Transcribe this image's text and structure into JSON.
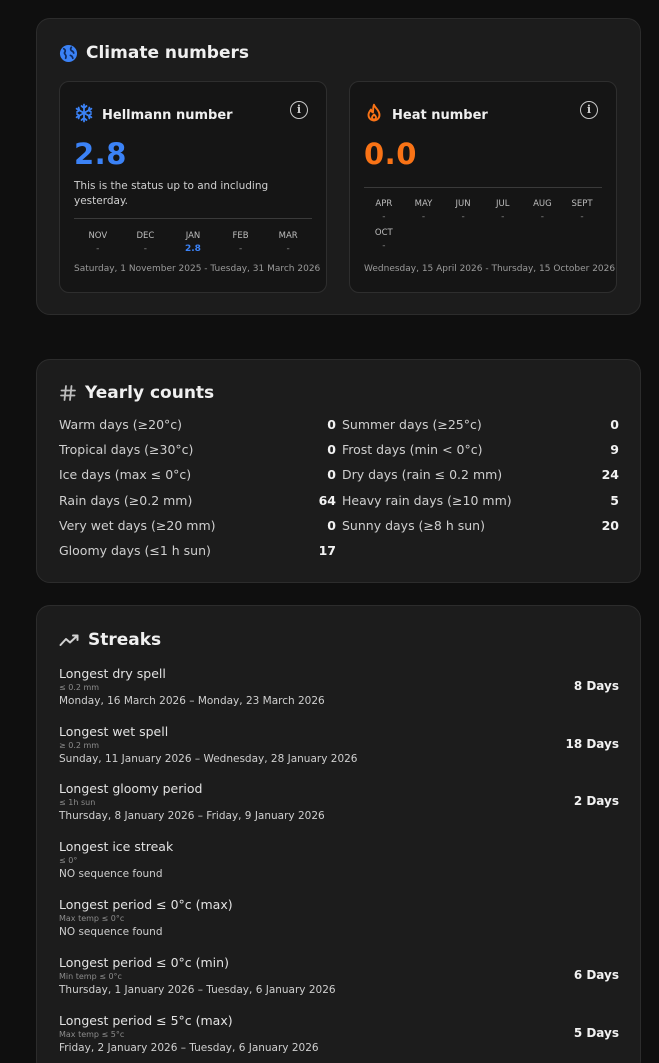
{
  "colors": {
    "blue": "#3b82f6",
    "orange": "#f97316"
  },
  "climate": {
    "title": "Climate numbers",
    "icon": "globe-icon",
    "hellmann": {
      "title": "Hellmann number",
      "icon": "snowflake-icon",
      "info_icon": "info-icon",
      "info_glyph": "i",
      "value": "2.8",
      "description": "This is the status up to and including yesterday.",
      "months": [
        {
          "label": "NOV",
          "value": "-"
        },
        {
          "label": "DEC",
          "value": "-"
        },
        {
          "label": "JAN",
          "value": "2.8"
        },
        {
          "label": "FEB",
          "value": "-"
        },
        {
          "label": "MAR",
          "value": "-"
        }
      ],
      "range": "Saturday, 1 November 2025 - Tuesday, 31 March 2026"
    },
    "heat": {
      "title": "Heat number",
      "icon": "flame-icon",
      "info_icon": "info-icon",
      "info_glyph": "i",
      "value": "0.0",
      "months": [
        {
          "label": "APR",
          "value": "-"
        },
        {
          "label": "MAY",
          "value": "-"
        },
        {
          "label": "JUN",
          "value": "-"
        },
        {
          "label": "JUL",
          "value": "-"
        },
        {
          "label": "AUG",
          "value": "-"
        },
        {
          "label": "SEPT",
          "value": "-"
        },
        {
          "label": "OCT",
          "value": "-"
        }
      ],
      "range": "Wednesday, 15 April 2026 - Thursday, 15 October 2026"
    }
  },
  "yearly": {
    "title": "Yearly counts",
    "icon": "hash-icon",
    "items": [
      {
        "label": "Warm days (≥20°c)",
        "value": "0"
      },
      {
        "label": "Summer days (≥25°c)",
        "value": "0"
      },
      {
        "label": "Tropical days (≥30°c)",
        "value": "0"
      },
      {
        "label": "Frost days (min < 0°c)",
        "value": "9"
      },
      {
        "label": "Ice days (max ≤ 0°c)",
        "value": "0"
      },
      {
        "label": "Dry days (rain ≤ 0.2 mm)",
        "value": "24"
      },
      {
        "label": "Rain days (≥0.2 mm)",
        "value": "64"
      },
      {
        "label": "Heavy rain days (≥10 mm)",
        "value": "5"
      },
      {
        "label": "Very wet days (≥20 mm)",
        "value": "0"
      },
      {
        "label": "Sunny days (≥8 h sun)",
        "value": "20"
      },
      {
        "label": "Gloomy days (≤1 h sun)",
        "value": "17"
      }
    ]
  },
  "streaks": {
    "title": "Streaks",
    "icon": "trend-line-icon",
    "items": [
      {
        "title": "Longest dry spell",
        "sub": "≤ 0.2 mm",
        "range": "Monday, 16 March 2026 – Monday, 23 March 2026",
        "value": "8 Days"
      },
      {
        "title": "Longest wet spell",
        "sub": "≥ 0.2 mm",
        "range": "Sunday, 11 January 2026 – Wednesday, 28 January 2026",
        "value": "18 Days"
      },
      {
        "title": "Longest gloomy period",
        "sub": "≤ 1h sun",
        "range": "Thursday, 8 January 2026 – Friday, 9 January 2026",
        "value": "2 Days"
      },
      {
        "title": "Longest ice streak",
        "sub": "≤ 0°",
        "range": "NO sequence found",
        "value": ""
      },
      {
        "title": "Longest period ≤ 0°c (max)",
        "sub": "Max temp ≤ 0°c",
        "range": "NO sequence found",
        "value": ""
      },
      {
        "title": "Longest period ≤ 0°c (min)",
        "sub": "Min temp ≤ 0°c",
        "range": "Thursday, 1 January 2026 – Tuesday, 6 January 2026",
        "value": "6 Days"
      },
      {
        "title": "Longest period ≤ 5°c (max)",
        "sub": "Max temp ≤ 5°c",
        "range": "Friday, 2 January 2026 – Tuesday, 6 January 2026",
        "value": "5 Days"
      }
    ]
  }
}
